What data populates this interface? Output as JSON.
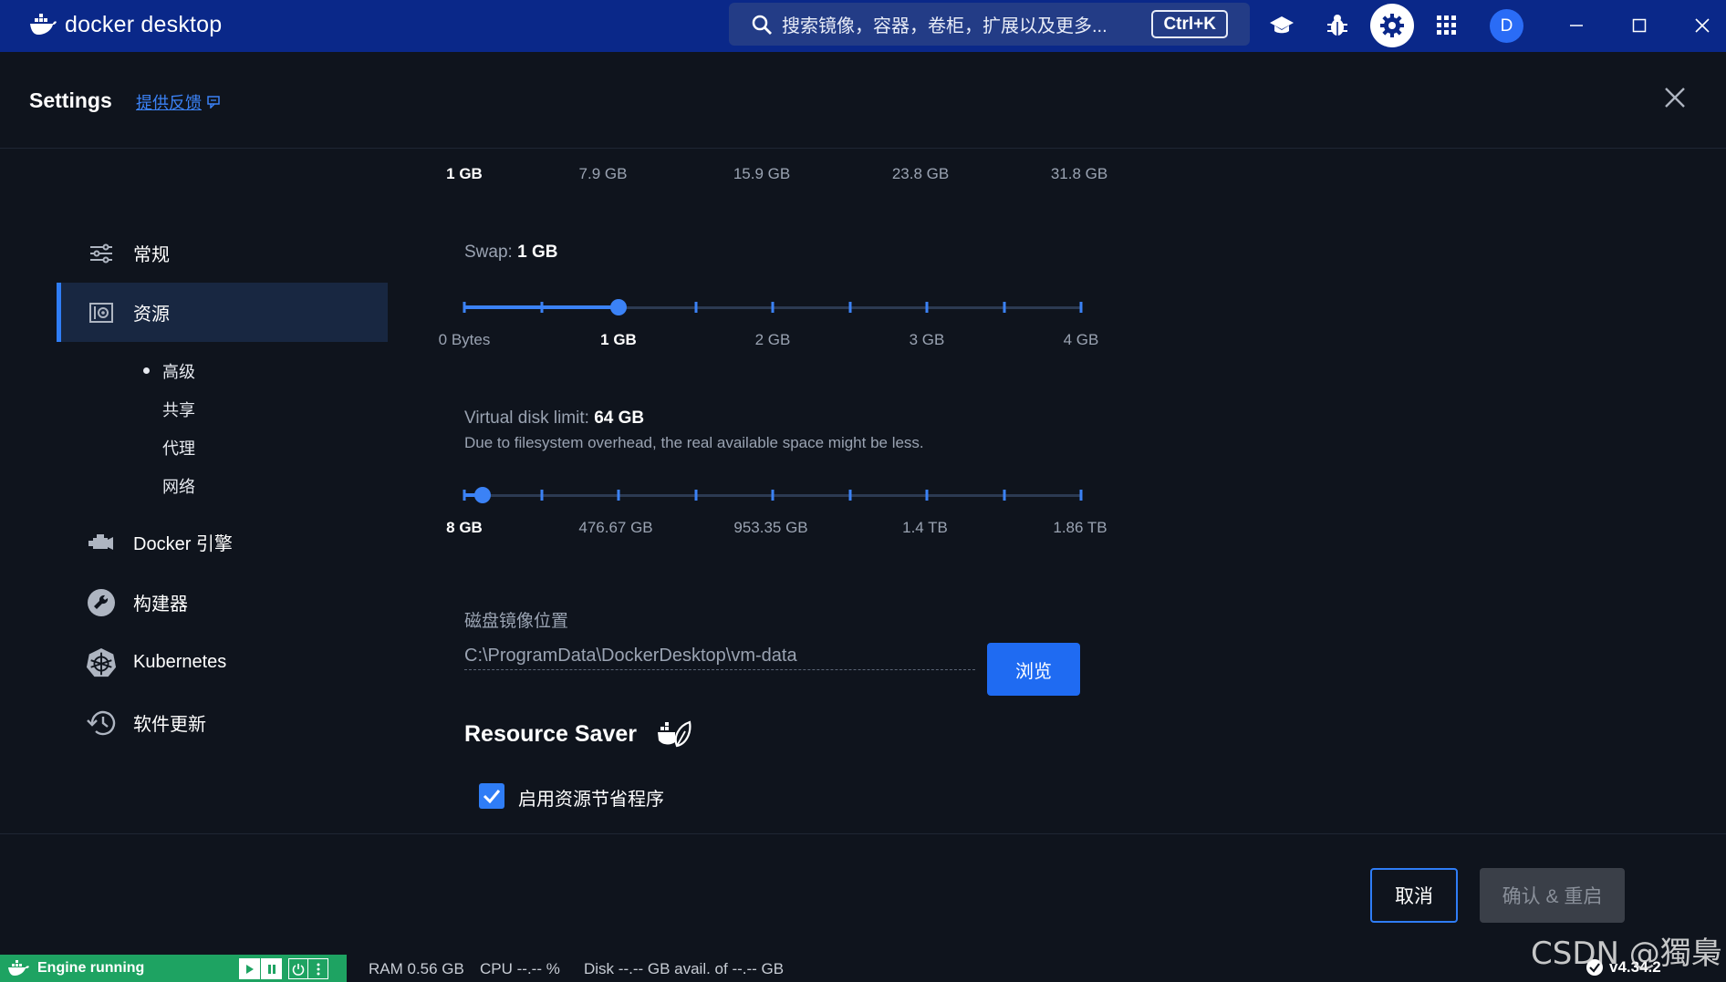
{
  "titlebar": {
    "logo_text_a": "docker",
    "logo_text_b": "desktop",
    "search_placeholder": "搜索镜像，容器，卷柜，扩展以及更多...",
    "search_shortcut": "Ctrl+K",
    "avatar_initial": "D",
    "icons": [
      "learning-center-icon",
      "bug-icon",
      "gear-icon",
      "apps-grid-icon"
    ]
  },
  "header": {
    "title": "Settings",
    "feedback": "提供反馈"
  },
  "sidebar": {
    "items": [
      {
        "label": "常规",
        "icon": "sliders-icon"
      },
      {
        "label": "资源",
        "icon": "resources-icon"
      },
      {
        "label": "Docker 引擎",
        "icon": "engine-icon"
      },
      {
        "label": "构建器",
        "icon": "wrench-icon"
      },
      {
        "label": "Kubernetes",
        "icon": "kubernetes-icon"
      },
      {
        "label": "软件更新",
        "icon": "history-icon"
      }
    ],
    "sub_items": [
      "高级",
      "共享",
      "代理",
      "网络"
    ]
  },
  "memory": {
    "ticks": [
      "1 GB",
      "7.9 GB",
      "15.9 GB",
      "23.8 GB",
      "31.8 GB"
    ]
  },
  "swap": {
    "label": "Swap:",
    "value": "1 GB",
    "ticks": [
      "0 Bytes",
      "1 GB",
      "2 GB",
      "3 GB",
      "4 GB"
    ],
    "fraction": 0.25
  },
  "disk": {
    "label": "Virtual disk limit:",
    "value": "64 GB",
    "help": "Due to filesystem overhead, the real available space might be less.",
    "ticks": [
      "8 GB",
      "476.67 GB",
      "953.35 GB",
      "1.4 TB",
      "1.86 TB"
    ],
    "fraction": 0.03
  },
  "disk_image": {
    "label": "磁盘镜像位置",
    "path": "C:\\ProgramData\\DockerDesktop\\vm-data",
    "browse": "浏览"
  },
  "resource_saver": {
    "title": "Resource Saver",
    "checkbox_label": "启用资源节省程序",
    "checked": true
  },
  "footer": {
    "cancel": "取消",
    "apply": "确认 & 重启"
  },
  "statusbar": {
    "engine": "Engine running",
    "ram": "RAM 0.56 GB",
    "cpu": "CPU --.-- %",
    "disk": "Disk --.-- GB avail. of --.-- GB",
    "version": "v4.34.2"
  },
  "watermark": "CSDN @獨梟",
  "colors": {
    "titlebar": "#0a2889",
    "accent": "#2f7df6",
    "engine_green": "#1ea362",
    "background": "#0f141d"
  }
}
